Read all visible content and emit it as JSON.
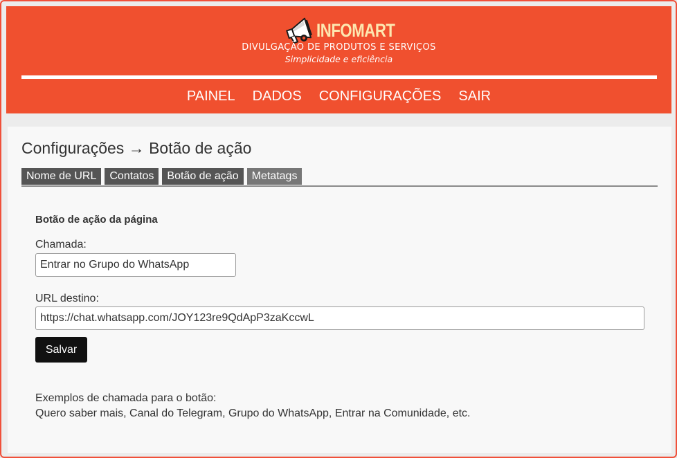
{
  "header": {
    "brand_name": "INFOMART",
    "subtitle": "DIVULGAÇÃO DE PRODUTOS E SERVIÇOS",
    "slogan": "Simplicidade e eficiência",
    "logo_icon": "megaphone-icon"
  },
  "nav": {
    "items": [
      {
        "label": "PAINEL"
      },
      {
        "label": "DADOS"
      },
      {
        "label": "CONFIGURAÇÕES"
      },
      {
        "label": "SAIR"
      }
    ]
  },
  "page": {
    "title": "Configurações → Botão de ação"
  },
  "tabs": [
    {
      "label": "Nome de URL",
      "active": false
    },
    {
      "label": "Contatos",
      "active": false
    },
    {
      "label": "Botão de ação",
      "active": false
    },
    {
      "label": "Metatags",
      "active": true
    }
  ],
  "form": {
    "section_title": "Botão de ação da página",
    "call_label": "Chamada:",
    "call_value": "Entrar no Grupo do WhatsApp",
    "url_label": "URL destino:",
    "url_value": "https://chat.whatsapp.com/JOY123re9QdApP3zaKccwL",
    "save_label": "Salvar"
  },
  "hint": {
    "line1": "Exemplos de chamada para o botão:",
    "line2": "Quero saber mais, Canal do Telegram, Grupo do WhatsApp, Entrar na Comunidade, etc."
  },
  "colors": {
    "header_bg": "#f0502f",
    "brand_text": "#fde7b0",
    "tab_bg": "#555555",
    "tab_active_bg": "#777777",
    "button_bg": "#111111"
  }
}
